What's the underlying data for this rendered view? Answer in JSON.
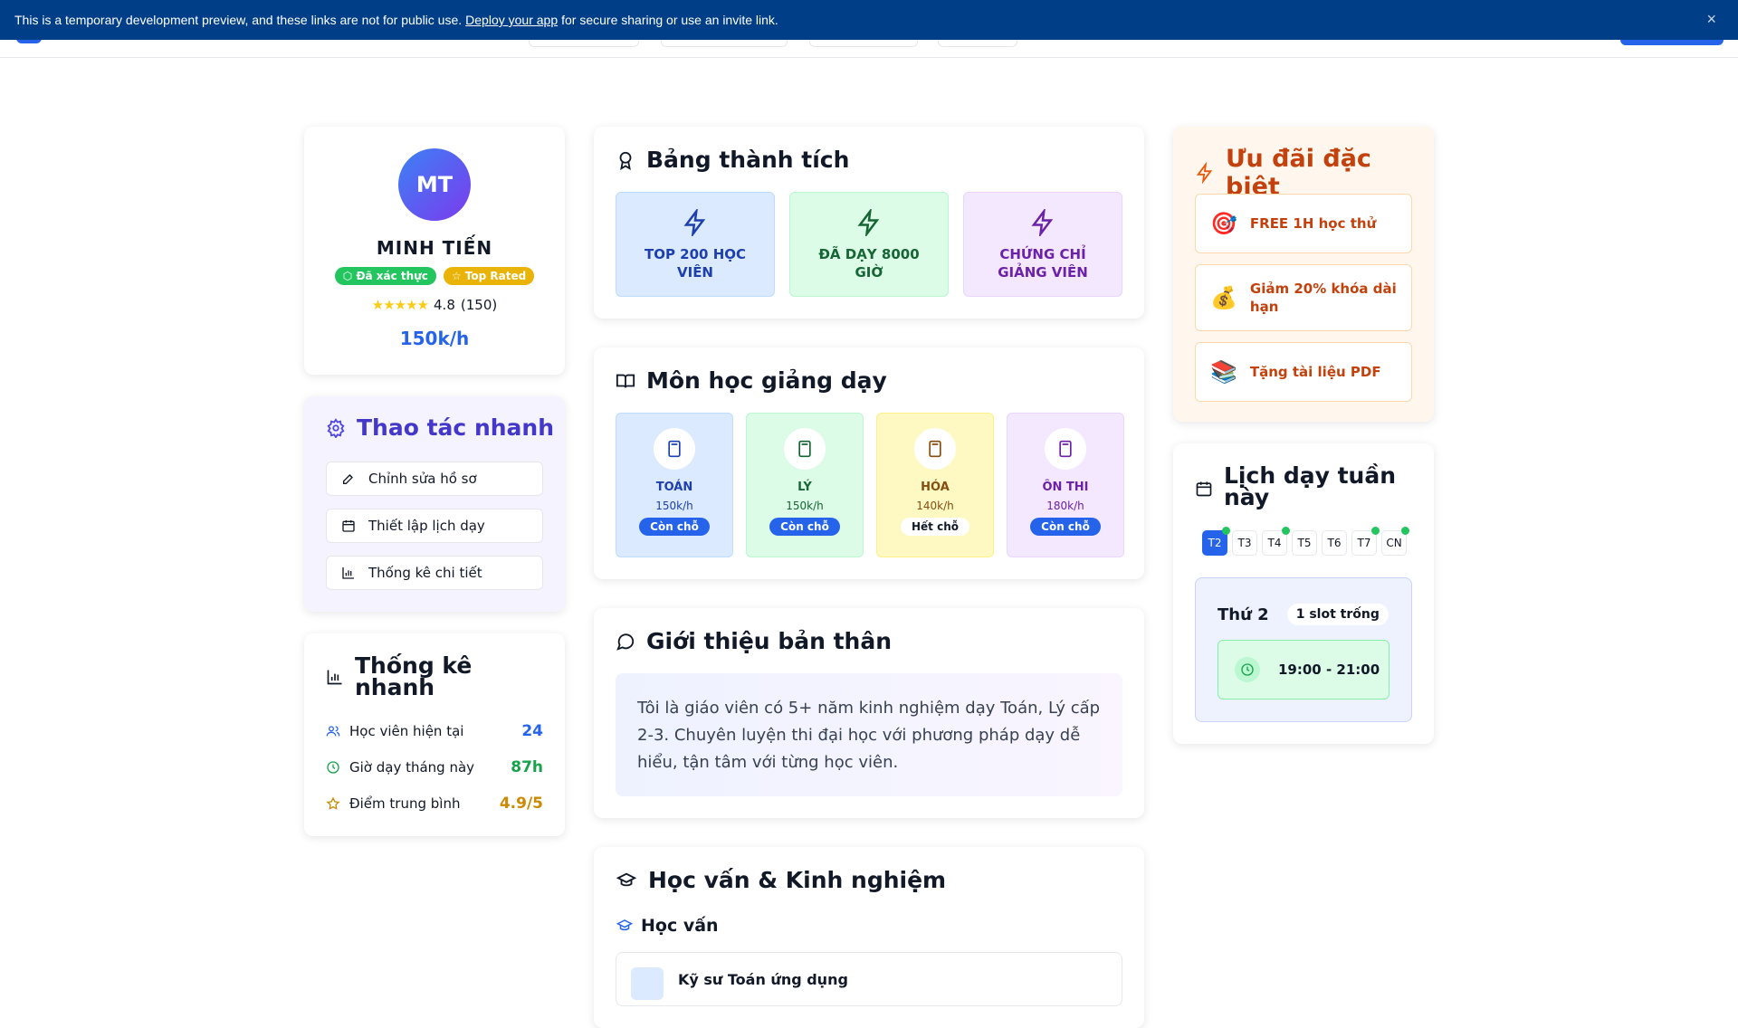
{
  "banner": {
    "text_before": "This is a temporary development preview, and these links are not for public use.",
    "link": "Deploy your app",
    "text_after": "for secure sharing or use an invite link.",
    "close": "×"
  },
  "profile": {
    "initials": "MT",
    "name": "MINH TIẾN",
    "badges": [
      "Đã xác thực",
      "Top Rated"
    ],
    "stars": "★★★★★",
    "rating": "4.8",
    "reviews": "(150)",
    "price": "150k/h"
  },
  "quick_actions": {
    "title": "Thao tác nhanh",
    "items": [
      "Chỉnh sửa hồ sơ",
      "Thiết lập lịch dạy",
      "Thống kê chi tiết"
    ]
  },
  "stats": {
    "title": "Thống kê nhanh",
    "items": [
      {
        "label": "Học viên hiện tại",
        "value": "24",
        "color": "#2563eb"
      },
      {
        "label": "Giờ dạy tháng này",
        "value": "87h",
        "color": "#16a34a"
      },
      {
        "label": "Điểm trung bình",
        "value": "4.9/5",
        "color": "#ca8a04"
      }
    ]
  },
  "achievements": {
    "title": "Bảng thành tích",
    "items": [
      {
        "label": "TOP 200 HỌC VIÊN",
        "color": "#1e40af",
        "bg": "#dbeafe"
      },
      {
        "label": "ĐÃ DẠY 8000 GIỜ",
        "color": "#166534",
        "bg": "#dcfce7"
      },
      {
        "label": "CHỨNG CHỈ GIẢNG VIÊN",
        "color": "#6b21a8",
        "bg": "#f3e8ff"
      }
    ]
  },
  "subjects": {
    "title": "Môn học giảng dạy",
    "items": [
      {
        "name": "TOÁN",
        "price": "150k/h",
        "status": "Còn chỗ",
        "available": true,
        "color": "#1e40af",
        "bg": "#dbeafe"
      },
      {
        "name": "LÝ",
        "price": "150k/h",
        "status": "Còn chỗ",
        "available": true,
        "color": "#166534",
        "bg": "#dcfce7"
      },
      {
        "name": "HÓA",
        "price": "140k/h",
        "status": "Hết chỗ",
        "available": false,
        "color": "#854d0e",
        "bg": "#fef9c3"
      },
      {
        "name": "ÔN THI",
        "price": "180k/h",
        "status": "Còn chỗ",
        "available": true,
        "color": "#6b21a8",
        "bg": "#f3e8ff"
      }
    ]
  },
  "intro": {
    "title": "Giới thiệu bản thân",
    "text": "Tôi là giáo viên có 5+ năm kinh nghiệm dạy Toán, Lý cấp 2-3. Chuyên luyện thi đại học với phương pháp dạy dễ hiểu, tận tâm với từng học viên."
  },
  "education": {
    "title": "Học vấn & Kinh nghiệm",
    "subtitle": "Học vấn",
    "first_item": "Kỹ sư Toán ứng dụng"
  },
  "offers": {
    "title": "Ưu đãi đặc biệt",
    "items": [
      {
        "icon": "🎯",
        "label": "FREE 1H học thử"
      },
      {
        "icon": "💰",
        "label": "Giảm 20% khóa dài hạn"
      },
      {
        "icon": "📚",
        "label": "Tặng tài liệu PDF"
      }
    ]
  },
  "schedule": {
    "title": "Lịch dạy tuần này",
    "days": [
      {
        "label": "T2",
        "active": true,
        "has_slot": true
      },
      {
        "label": "T3",
        "active": false,
        "has_slot": false
      },
      {
        "label": "T4",
        "active": false,
        "has_slot": true
      },
      {
        "label": "T5",
        "active": false,
        "has_slot": false
      },
      {
        "label": "T6",
        "active": false,
        "has_slot": false
      },
      {
        "label": "T7",
        "active": false,
        "has_slot": true
      },
      {
        "label": "CN",
        "active": false,
        "has_slot": true
      }
    ],
    "selected_day": "Thứ 2",
    "slot_count": "1 slot trống",
    "slot_time": "19:00 - 21:00"
  }
}
